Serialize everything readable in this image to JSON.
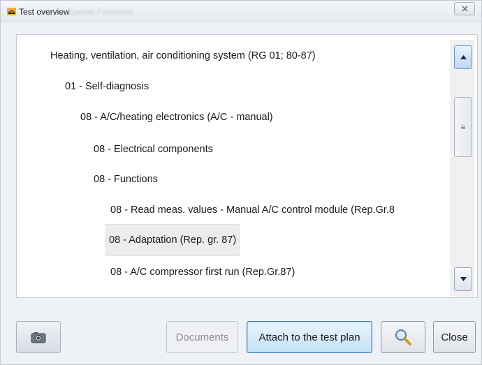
{
  "window": {
    "title": "Test overview",
    "ghost_title": "Special Functions",
    "close_icon": "close-icon"
  },
  "tree": {
    "items": [
      {
        "label": "Heating, ventilation, air conditioning system (RG 01; 80-87)",
        "level": 0,
        "selected": false
      },
      {
        "label": "01 - Self-diagnosis",
        "level": 1,
        "selected": false
      },
      {
        "label": "08 - A/C/heating electronics (A/C - manual)",
        "level": 2,
        "selected": false
      },
      {
        "label": "08 - Electrical components",
        "level": 3,
        "selected": false
      },
      {
        "label": "08 - Functions",
        "level": 3,
        "selected": false
      },
      {
        "label": "08 - Read meas. values - Manual A/C control module (Rep.Gr.8",
        "level": 4,
        "selected": false
      },
      {
        "label": "08 - Adaptation (Rep. gr. 87)",
        "level": 4,
        "selected": true
      },
      {
        "label": "08 - A/C compressor first run (Rep.Gr.87)",
        "level": 4,
        "selected": false
      }
    ]
  },
  "buttons": {
    "camera_icon": "camera-icon",
    "documents": "Documents",
    "attach": "Attach to the test plan",
    "search_icon": "magnifier-icon",
    "close": "Close"
  },
  "colors": {
    "primary_button": "#c4e1f6",
    "selected_item": "#ececec"
  }
}
